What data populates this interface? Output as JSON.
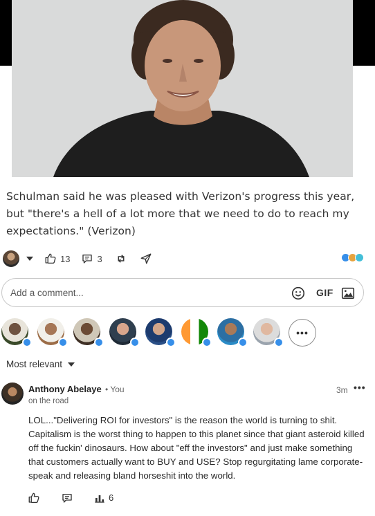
{
  "post": {
    "caption": "Schulman said he was pleased with Verizon's progress this year, but \"there's a hell of a lot more that we need to do to reach my expectations.\" (Verizon)",
    "likes_count": "13",
    "comments_count": "3"
  },
  "comment_input": {
    "placeholder": "Add a comment...",
    "gif_label": "GIF"
  },
  "reactors": {
    "more_label": "•••"
  },
  "sort": {
    "label": "Most relevant"
  },
  "comment": {
    "author": "Anthony Abelaye",
    "you_label": "• You",
    "subtitle": "on the road",
    "time": "3m",
    "more_label": "•••",
    "text": "LOL...\"Delivering ROI for investors\" is the reason the world is turning to shit. Capitalism is the worst thing to happen to this planet since that giant asteroid killed off the fuckin' dinosaurs. How about \"eff the investors\" and just make something that customers actually want to BUY and USE? Stop regurgitating lame corporate-speak and releasing bland horseshit into the world.",
    "impressions_count": "6"
  },
  "colors": {
    "reaction_like": "#378fe9",
    "reaction_celebrate": "#6dae4f",
    "reaction_funny": "#44bfd8",
    "photo_background": "#d9dada"
  }
}
